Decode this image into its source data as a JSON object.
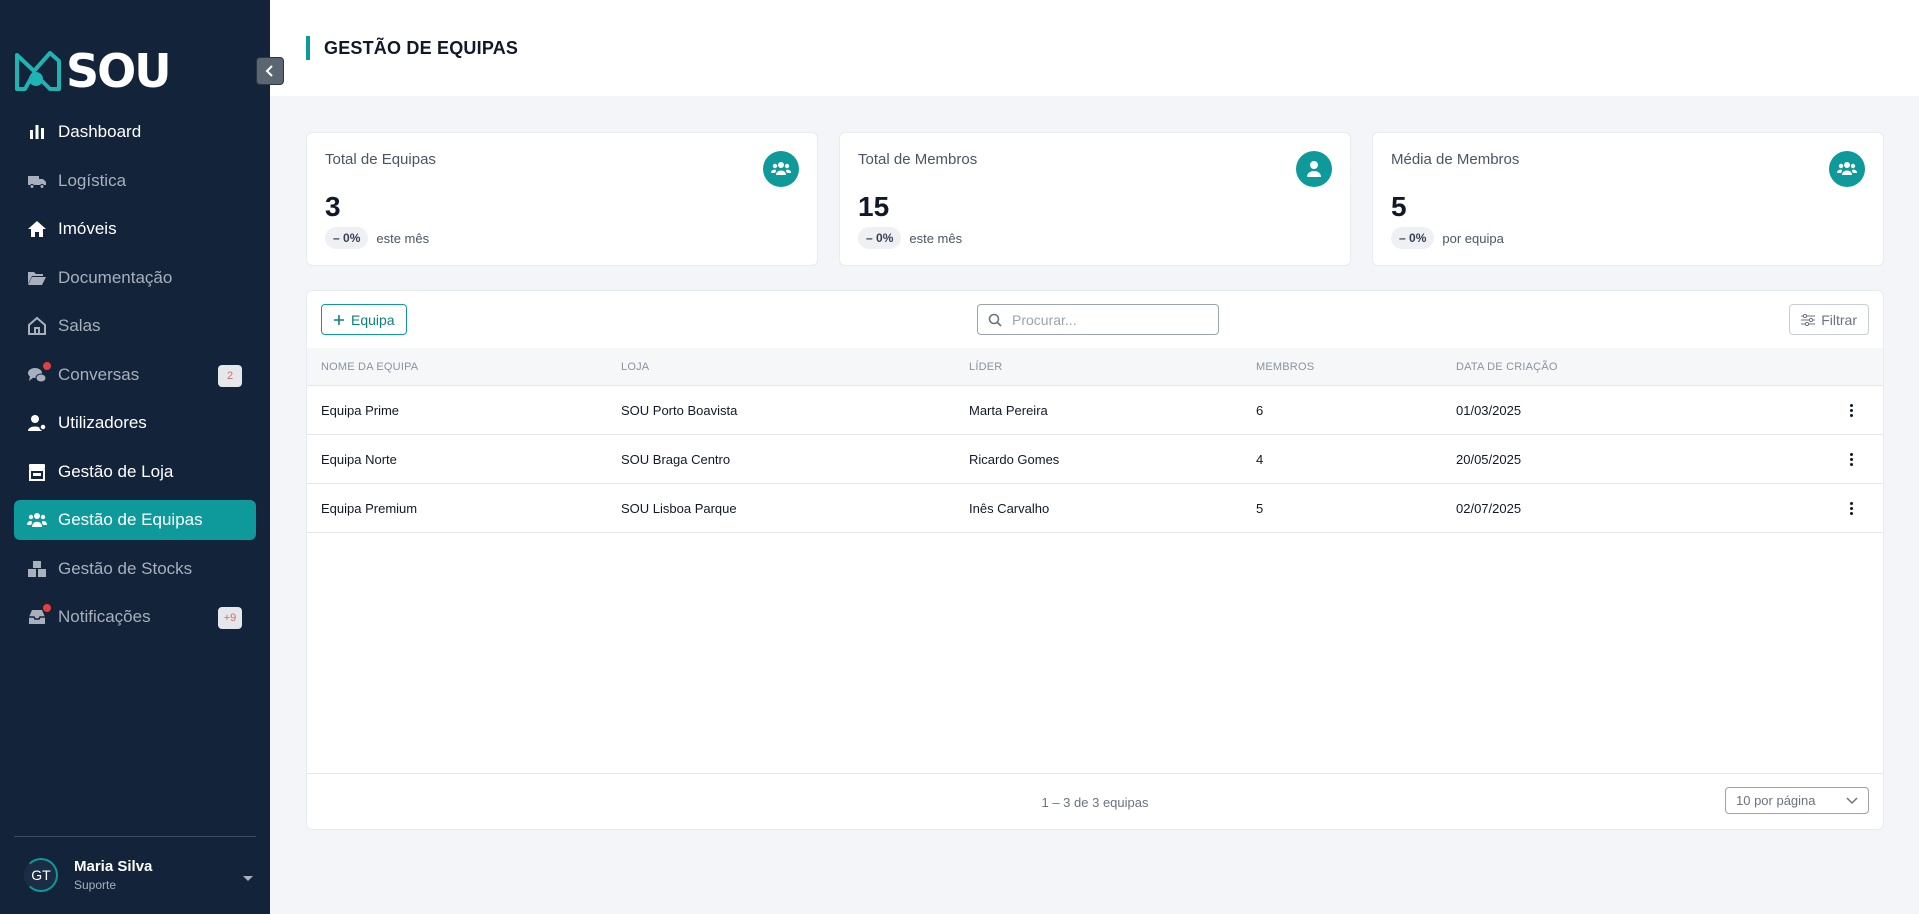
{
  "brand": {
    "name": "SOU",
    "accent": "#0e9a9a",
    "sidebar_bg": "#13233a"
  },
  "sidebar": {
    "items": [
      {
        "label": "Dashboard",
        "icon": "bar-chart-icon"
      },
      {
        "label": "Logística",
        "icon": "truck-icon"
      },
      {
        "label": "Imóveis",
        "icon": "home-icon"
      },
      {
        "label": "Documentação",
        "icon": "folder-open-icon"
      },
      {
        "label": "Salas",
        "icon": "house-outline-icon"
      },
      {
        "label": "Conversas",
        "icon": "chat-icon",
        "badge": "2"
      },
      {
        "label": "Utilizadores",
        "icon": "user-gear-icon"
      },
      {
        "label": "Gestão de Loja",
        "icon": "store-icon"
      },
      {
        "label": "Gestão de Equipas",
        "icon": "users-icon",
        "active": true
      },
      {
        "label": "Gestão de Stocks",
        "icon": "boxes-icon"
      },
      {
        "label": "Notificações",
        "icon": "inbox-icon",
        "badge": "+9"
      }
    ],
    "user": {
      "initials": "GT",
      "name": "Maria Silva",
      "role": "Suporte"
    }
  },
  "header": {
    "title": "GESTÃO DE EQUIPAS"
  },
  "stats": [
    {
      "label": "Total de Equipas",
      "value": "3",
      "change": "0%",
      "suffix": "este mês",
      "icon": "users-icon"
    },
    {
      "label": "Total de Membros",
      "value": "15",
      "change": "0%",
      "suffix": "este mês",
      "icon": "user-icon"
    },
    {
      "label": "Média de Membros",
      "value": "5",
      "change": "0%",
      "suffix": "por equipa",
      "icon": "users-icon"
    }
  ],
  "toolbar": {
    "add_label": "Equipa",
    "search_placeholder": "Procurar...",
    "filter_label": "Filtrar"
  },
  "table": {
    "columns": [
      "NOME DA EQUIPA",
      "LOJA",
      "LÍDER",
      "MEMBROS",
      "DATA DE CRIAÇÃO"
    ],
    "rows": [
      [
        "Equipa Prime",
        "SOU Porto Boavista",
        "Marta Pereira",
        "6",
        "01/03/2025"
      ],
      [
        "Equipa Norte",
        "SOU Braga Centro",
        "Ricardo Gomes",
        "4",
        "20/05/2025"
      ],
      [
        "Equipa Premium",
        "SOU Lisboa Parque",
        "Inês Carvalho",
        "5",
        "02/07/2025"
      ]
    ]
  },
  "pagination": {
    "info": "1 – 3 de 3 equipas",
    "per_page": "10 por página"
  }
}
